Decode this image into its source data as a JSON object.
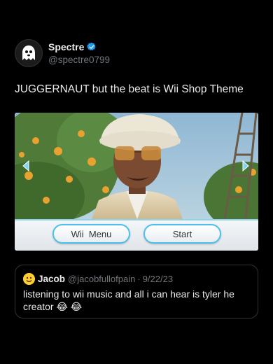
{
  "tweet": {
    "author": {
      "display_name": "Spectre",
      "handle": "@spectre0799",
      "verified": true,
      "avatar_icon": "ghost-icon"
    },
    "text": "JUGGERNAUT but the beat is Wii Shop Theme",
    "media": {
      "wii_buttons": [
        "Wii  Menu",
        "Start"
      ]
    },
    "quoted": {
      "avatar_icon": "smiling-face-emoji",
      "display_name": "Jacob",
      "handle": "@jacobfullofpain",
      "separator": "·",
      "date": "9/22/23",
      "text": "listening to wii music and all i can hear is tyler he creator",
      "emojis": [
        "😂",
        "😂"
      ]
    }
  },
  "colors": {
    "background": "#000000",
    "text": "#e7e9ea",
    "muted": "#71767b",
    "verified": "#1d9bf0",
    "wii_accent": "#4cc0ec",
    "border": "#2f3336"
  }
}
